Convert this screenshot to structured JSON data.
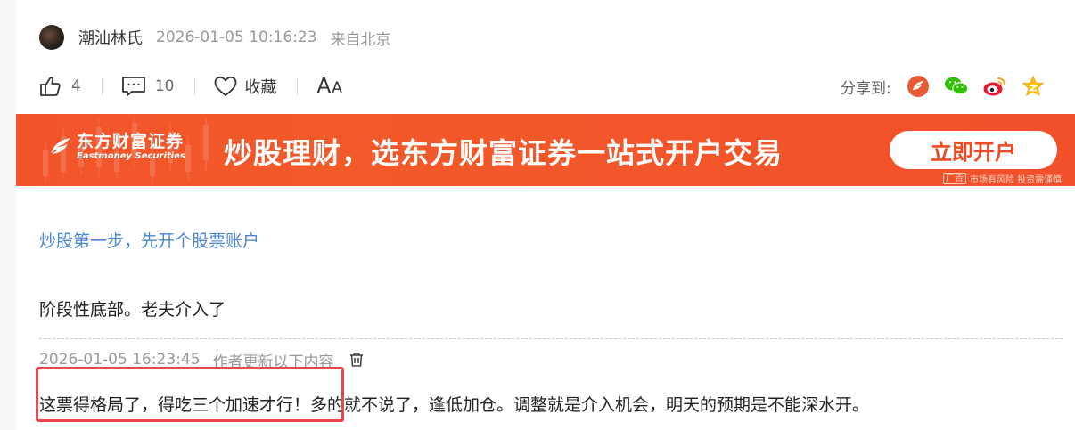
{
  "post": {
    "author": "潮汕林氏",
    "time": "2026-01-05 10:16:23",
    "location": "来自北京"
  },
  "actions": {
    "likes": "4",
    "comments": "10",
    "favorite_label": "收藏",
    "font_big": "A",
    "font_small": "A",
    "share_label": "分享到:"
  },
  "share_icons": [
    "share-icon",
    "wechat-icon",
    "weibo-icon",
    "qzone-icon"
  ],
  "banner": {
    "logo_cn": "东方财富证券",
    "logo_en": "Eastmoney Securities",
    "slogan": "炒股理财，选东方财富证券一站式开户交易",
    "button": "立即开户",
    "ad_tag": "广告",
    "disclaimer": "市场有风险 投资需谨慎"
  },
  "promo_link": "炒股第一步，先开个股票账户",
  "content": "阶段性底部。老夫介入了",
  "update": {
    "time": "2026-01-05 16:23:45",
    "note": "作者更新以下内容",
    "text": "这票得格局了，得吃三个加速才行！多的就不说了，逢低加仓。调整就是介入机会，明天的预期是不能深水开。"
  },
  "colors": {
    "accent_link": "#4b86d6",
    "banner_bg": "#f2542a",
    "highlight": "#e8484d"
  }
}
